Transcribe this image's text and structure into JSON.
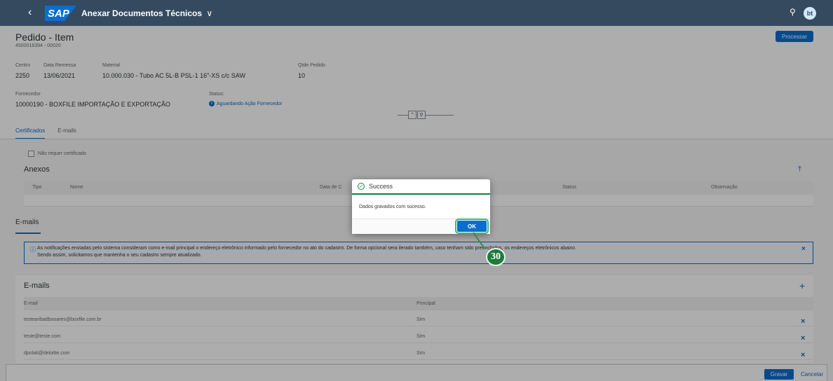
{
  "shell": {
    "back_icon": "‹",
    "logo": "SAP",
    "title": "Anexar Documentos Técnicos",
    "title_chevron": "∨",
    "search_icon": "⚲",
    "avatar": "bt"
  },
  "header": {
    "title": "Pedido - Item",
    "subtitle": "4500016394 - 00020",
    "process_button": "Processar"
  },
  "fields": {
    "centro_label": "Centro",
    "centro_value": "2250",
    "remessa_label": "Data Remessa",
    "remessa_value": "13/06/2021",
    "material_label": "Material",
    "material_value": "10.000.030 - Tubo AC 5L-B PSL-1 16\"-XS c/c SAW",
    "qtde_label": "Qtde Pedido",
    "qtde_value": "10",
    "fornecedor_label": "Fornecedor",
    "fornecedor_value": "10000190 - BOXFILE IMPORTAÇÃO E EXPORTAÇÃO",
    "status_label": "Status:",
    "status_value": "Aguardando Ação Fornecedor"
  },
  "collapse": {
    "btn1": "⌃",
    "btn2": "⚲"
  },
  "tabs": [
    {
      "label": "Certificados"
    },
    {
      "label": "E-mails"
    }
  ],
  "anexos": {
    "checkbox_label": "Não requer certificado",
    "title": "Anexos",
    "upload_icon": "⤒",
    "columns": [
      "Tipo",
      "Nome",
      "Data de C",
      "Status",
      "Observação"
    ]
  },
  "emails_section": {
    "title": "E-mails",
    "info_line1": "As notificações enviadas pelo sistema consideram como e-mail principal o endereço eletrônico informado pelo fornecedor no ato do cadastro. De forma opcional sera   ilerado também, caso tenham sido preenchidos, os endereços eletrônicos abaixo.",
    "info_line2": "Sendo assim, solicitamos que mantenha o seu cadastro sempre atualizado.",
    "info_close": "×"
  },
  "emails_table": {
    "title": "E-mails",
    "add_icon": "+",
    "columns": [
      "E-mail",
      "Principal"
    ],
    "rows": [
      {
        "email": "testearibadbooares@boxfile.com.br",
        "principal": "Sim"
      },
      {
        "email": "teste@teste.com",
        "principal": "Sim"
      },
      {
        "email": "dpolati@deloitte.com",
        "principal": "Sim"
      }
    ],
    "delete_icon": "×"
  },
  "footer": {
    "save": "Gravar",
    "cancel": "Cancelar"
  },
  "dialog": {
    "title": "Success",
    "icon": "✓",
    "message": "Dados gravados com sucesso.",
    "ok": "OK"
  },
  "callout": {
    "number": "30"
  },
  "colors": {
    "shell": "#354a5f",
    "accent": "#0a6ed1",
    "success": "#107e3e",
    "callout": "#1f7a3d"
  }
}
